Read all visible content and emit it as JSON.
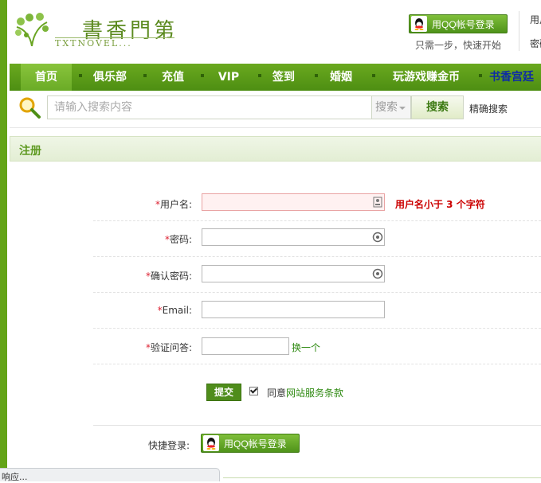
{
  "header": {
    "logo_title": "書香門第",
    "logo_subtitle": "TXTNOVEL...",
    "qq_login_label": "用QQ帐号登录",
    "qq_hint": "只需一步，快速开始",
    "user_link_1": "用户名",
    "user_link_2": "密码"
  },
  "nav": {
    "items": [
      {
        "label": "首页"
      },
      {
        "label": "俱乐部"
      },
      {
        "label": "充值"
      },
      {
        "label": "VIP"
      },
      {
        "label": "签到"
      },
      {
        "label": "婚姻"
      },
      {
        "label": "玩游戏赚金币"
      },
      {
        "label": "书香宫廷"
      }
    ]
  },
  "search": {
    "placeholder": "请输入搜索内容",
    "scope": "搜索",
    "button": "搜索",
    "exact": "精确搜索"
  },
  "panel": {
    "title": "注册"
  },
  "form": {
    "required_mark": "*",
    "username_label": "用户名:",
    "username_error": "用户名小于 3 个字符",
    "password_label": "密码:",
    "confirm_label": "确认密码:",
    "email_label": "Email:",
    "captcha_label": "验证问答:",
    "captcha_refresh": "换一个",
    "submit": "提交",
    "agree_prefix": "同意",
    "agree_link": "网站服务条款",
    "quick_login_label": "快捷登录:",
    "quick_qq_label": "用QQ帐号登录"
  },
  "status_bar": {
    "text": "响应..."
  },
  "colors": {
    "brand_green": "#63a418",
    "nav_special": "#0d2aa6",
    "error_red": "#c00000"
  }
}
